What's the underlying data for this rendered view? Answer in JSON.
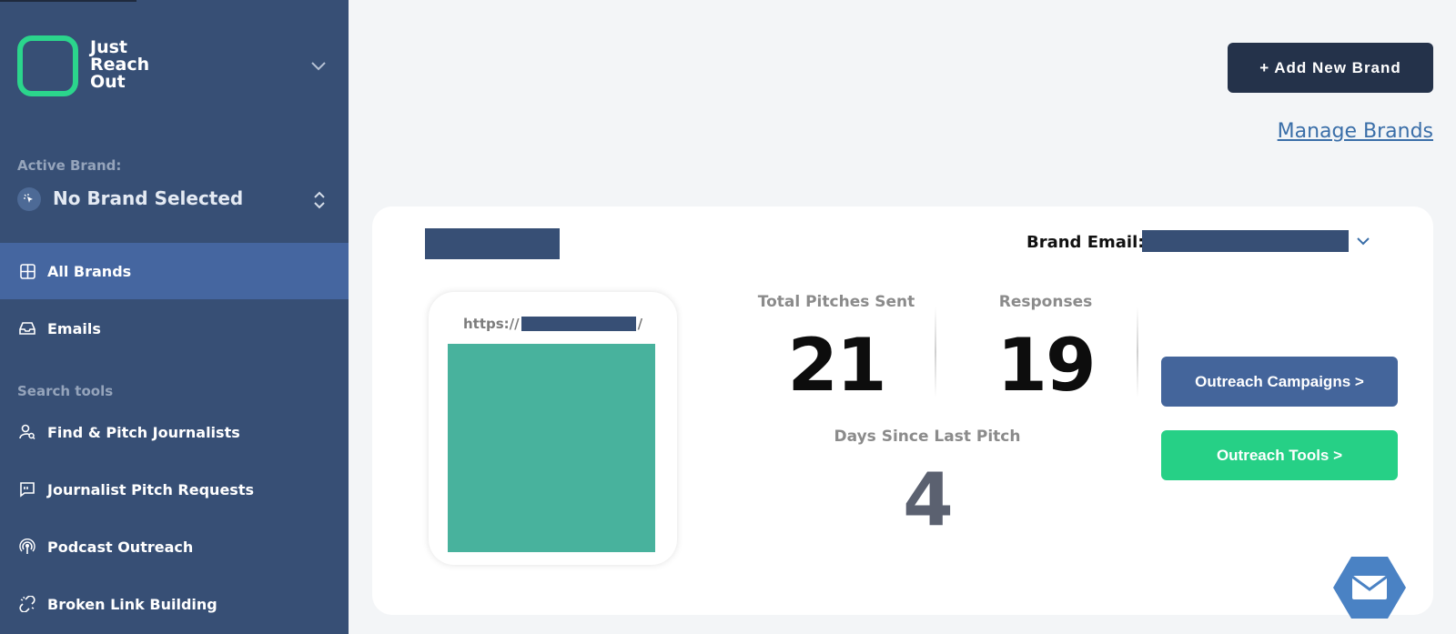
{
  "logo": {
    "line1": "Just",
    "line2": "Reach",
    "line3": "Out"
  },
  "sidebar": {
    "active_brand_label": "Active Brand:",
    "active_brand_value": "No Brand Selected",
    "nav": [
      {
        "label": "All Brands",
        "icon": "grid-icon"
      },
      {
        "label": "Emails",
        "icon": "inbox-icon"
      }
    ],
    "section_label": "Search tools",
    "tools": [
      {
        "label": "Find & Pitch Journalists",
        "icon": "user-search-icon"
      },
      {
        "label": "Journalist Pitch Requests",
        "icon": "quote-chat-icon"
      },
      {
        "label": "Podcast Outreach",
        "icon": "podcast-icon"
      },
      {
        "label": "Broken Link Building",
        "icon": "broken-link-icon"
      }
    ]
  },
  "header": {
    "add_brand_label": "+ Add New Brand",
    "manage_brands_label": "Manage Brands"
  },
  "card": {
    "brand_email_label": "Brand Email:",
    "url_prefix": "https://",
    "url_suffix": "/",
    "stats": {
      "total_pitches_label": "Total Pitches Sent",
      "total_pitches_value": "21",
      "responses_label": "Responses",
      "responses_value": "19",
      "days_label": "Days Since Last Pitch",
      "days_value": "4"
    },
    "campaigns_label": "Outreach Campaigns >",
    "tools_label": "Outreach Tools >"
  },
  "colors": {
    "sidebar_bg": "#374f75",
    "sidebar_active": "#4566a0",
    "accent_green": "#26d086",
    "primary_dark": "#24324a",
    "campaign_blue": "#44659b",
    "preview_teal": "#48b29d"
  }
}
